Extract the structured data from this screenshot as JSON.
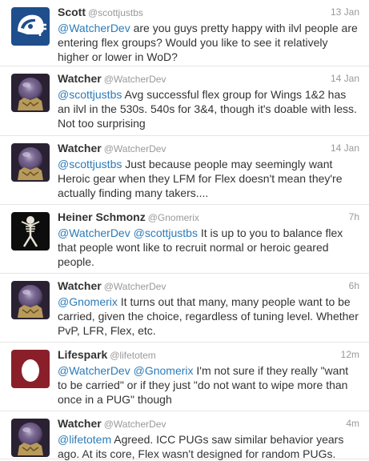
{
  "tweets": [
    {
      "avatar": "helmet-logo-icon",
      "fullname": "Scott",
      "username": "@scottjustbs",
      "time": "13 Jan",
      "text_parts": [
        {
          "mention": "@WatcherDev"
        },
        {
          "text": " are you guys pretty happy with ilvl people are entering flex groups? Would you like to see it relatively higher or lower in WoD?"
        }
      ]
    },
    {
      "avatar": "crystal-orb-icon",
      "fullname": "Watcher",
      "username": "@WatcherDev",
      "time": "14 Jan",
      "text_parts": [
        {
          "mention": "@scottjustbs"
        },
        {
          "text": " Avg successful flex group for Wings 1&2 has an ilvl in the 530s. 540s for 3&4, though it's doable with less. Not too surprising"
        }
      ]
    },
    {
      "avatar": "crystal-orb-icon",
      "fullname": "Watcher",
      "username": "@WatcherDev",
      "time": "14 Jan",
      "text_parts": [
        {
          "mention": "@scottjustbs"
        },
        {
          "text": " Just because people may seemingly want Heroic gear when they LFM for Flex doesn't mean they're actually finding many takers...."
        }
      ]
    },
    {
      "avatar": "skeleton-icon",
      "fullname": "Heiner Schmonz",
      "username": "@Gnomerix",
      "time": "7h",
      "text_parts": [
        {
          "mention": "@WatcherDev"
        },
        {
          "text": " "
        },
        {
          "mention": "@scottjustbs"
        },
        {
          "text": " It is up to you to balance flex that people wont like to recruit normal or heroic geared people."
        }
      ]
    },
    {
      "avatar": "crystal-orb-icon",
      "fullname": "Watcher",
      "username": "@WatcherDev",
      "time": "6h",
      "text_parts": [
        {
          "mention": "@Gnomerix"
        },
        {
          "text": " It turns out that many, many people want to be carried, given the choice, regardless of tuning level. Whether PvP, LFR, Flex, etc."
        }
      ]
    },
    {
      "avatar": "egg-icon",
      "fullname": "Lifespark",
      "username": "@lifetotem",
      "time": "12m",
      "text_parts": [
        {
          "mention": "@WatcherDev"
        },
        {
          "text": " "
        },
        {
          "mention": "@Gnomerix"
        },
        {
          "text": " I'm not sure if they really \"want to be carried\" or if they just \"do not want to wipe more than once in a PUG\" though"
        }
      ]
    },
    {
      "avatar": "crystal-orb-icon",
      "fullname": "Watcher",
      "username": "@WatcherDev",
      "time": "4m",
      "text_parts": [
        {
          "mention": "@lifetotem"
        },
        {
          "text": " Agreed. ICC PUGs saw similar behavior years ago. At its core, Flex wasn't designed for random PUGs."
        }
      ]
    }
  ],
  "colors": {
    "mention": "#2b7bb9",
    "muted": "#999999",
    "text": "#333333",
    "divider": "#e6e6e6"
  }
}
